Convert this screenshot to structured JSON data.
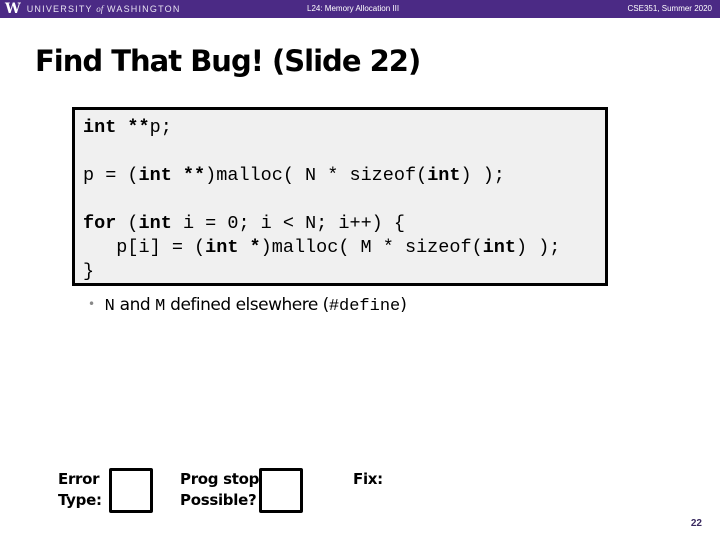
{
  "header": {
    "logo_glyph": "W",
    "university_pre": "UNIVERSITY",
    "university_of": "of",
    "university_post": "WASHINGTON",
    "lecture": "L24: Memory Allocation III",
    "course": "CSE351, Summer 2020",
    "color": "#4b2a85"
  },
  "slide": {
    "title": "Find That Bug!  (Slide 22)",
    "code": {
      "lines": [
        [
          {
            "t": "int **",
            "b": true
          },
          {
            "t": "p;",
            "b": false
          }
        ],
        [],
        [
          {
            "t": "p = (",
            "b": false
          },
          {
            "t": "int **",
            "b": true
          },
          {
            "t": ")malloc( N * sizeof(",
            "b": false
          },
          {
            "t": "int",
            "b": true
          },
          {
            "t": ") );",
            "b": false
          }
        ],
        [],
        [
          {
            "t": "for",
            "b": true
          },
          {
            "t": " (",
            "b": false
          },
          {
            "t": "int",
            "b": true
          },
          {
            "t": " i = 0; i < N; i++) {",
            "b": false
          }
        ],
        [
          {
            "t": "   p[i] = (",
            "b": false
          },
          {
            "t": "int *",
            "b": true
          },
          {
            "t": ")malloc( M * sizeof(",
            "b": false
          },
          {
            "t": "int",
            "b": true
          },
          {
            "t": ") );",
            "b": false
          }
        ],
        [
          {
            "t": "}",
            "b": false
          }
        ]
      ]
    },
    "bullet": {
      "n": "N",
      "and": " and ",
      "m": "M",
      "rest": " defined elsewhere (",
      "define": "#define",
      "close": ")"
    },
    "answers": {
      "error_type_label_1": "Error",
      "error_type_label_2": "Type:",
      "prog_stop_label_1": "Prog stop",
      "prog_stop_label_2": "Possible?",
      "fix_label": "Fix:",
      "error_type_value": "",
      "prog_stop_value": "",
      "fix_value": ""
    },
    "page_number": "22"
  }
}
